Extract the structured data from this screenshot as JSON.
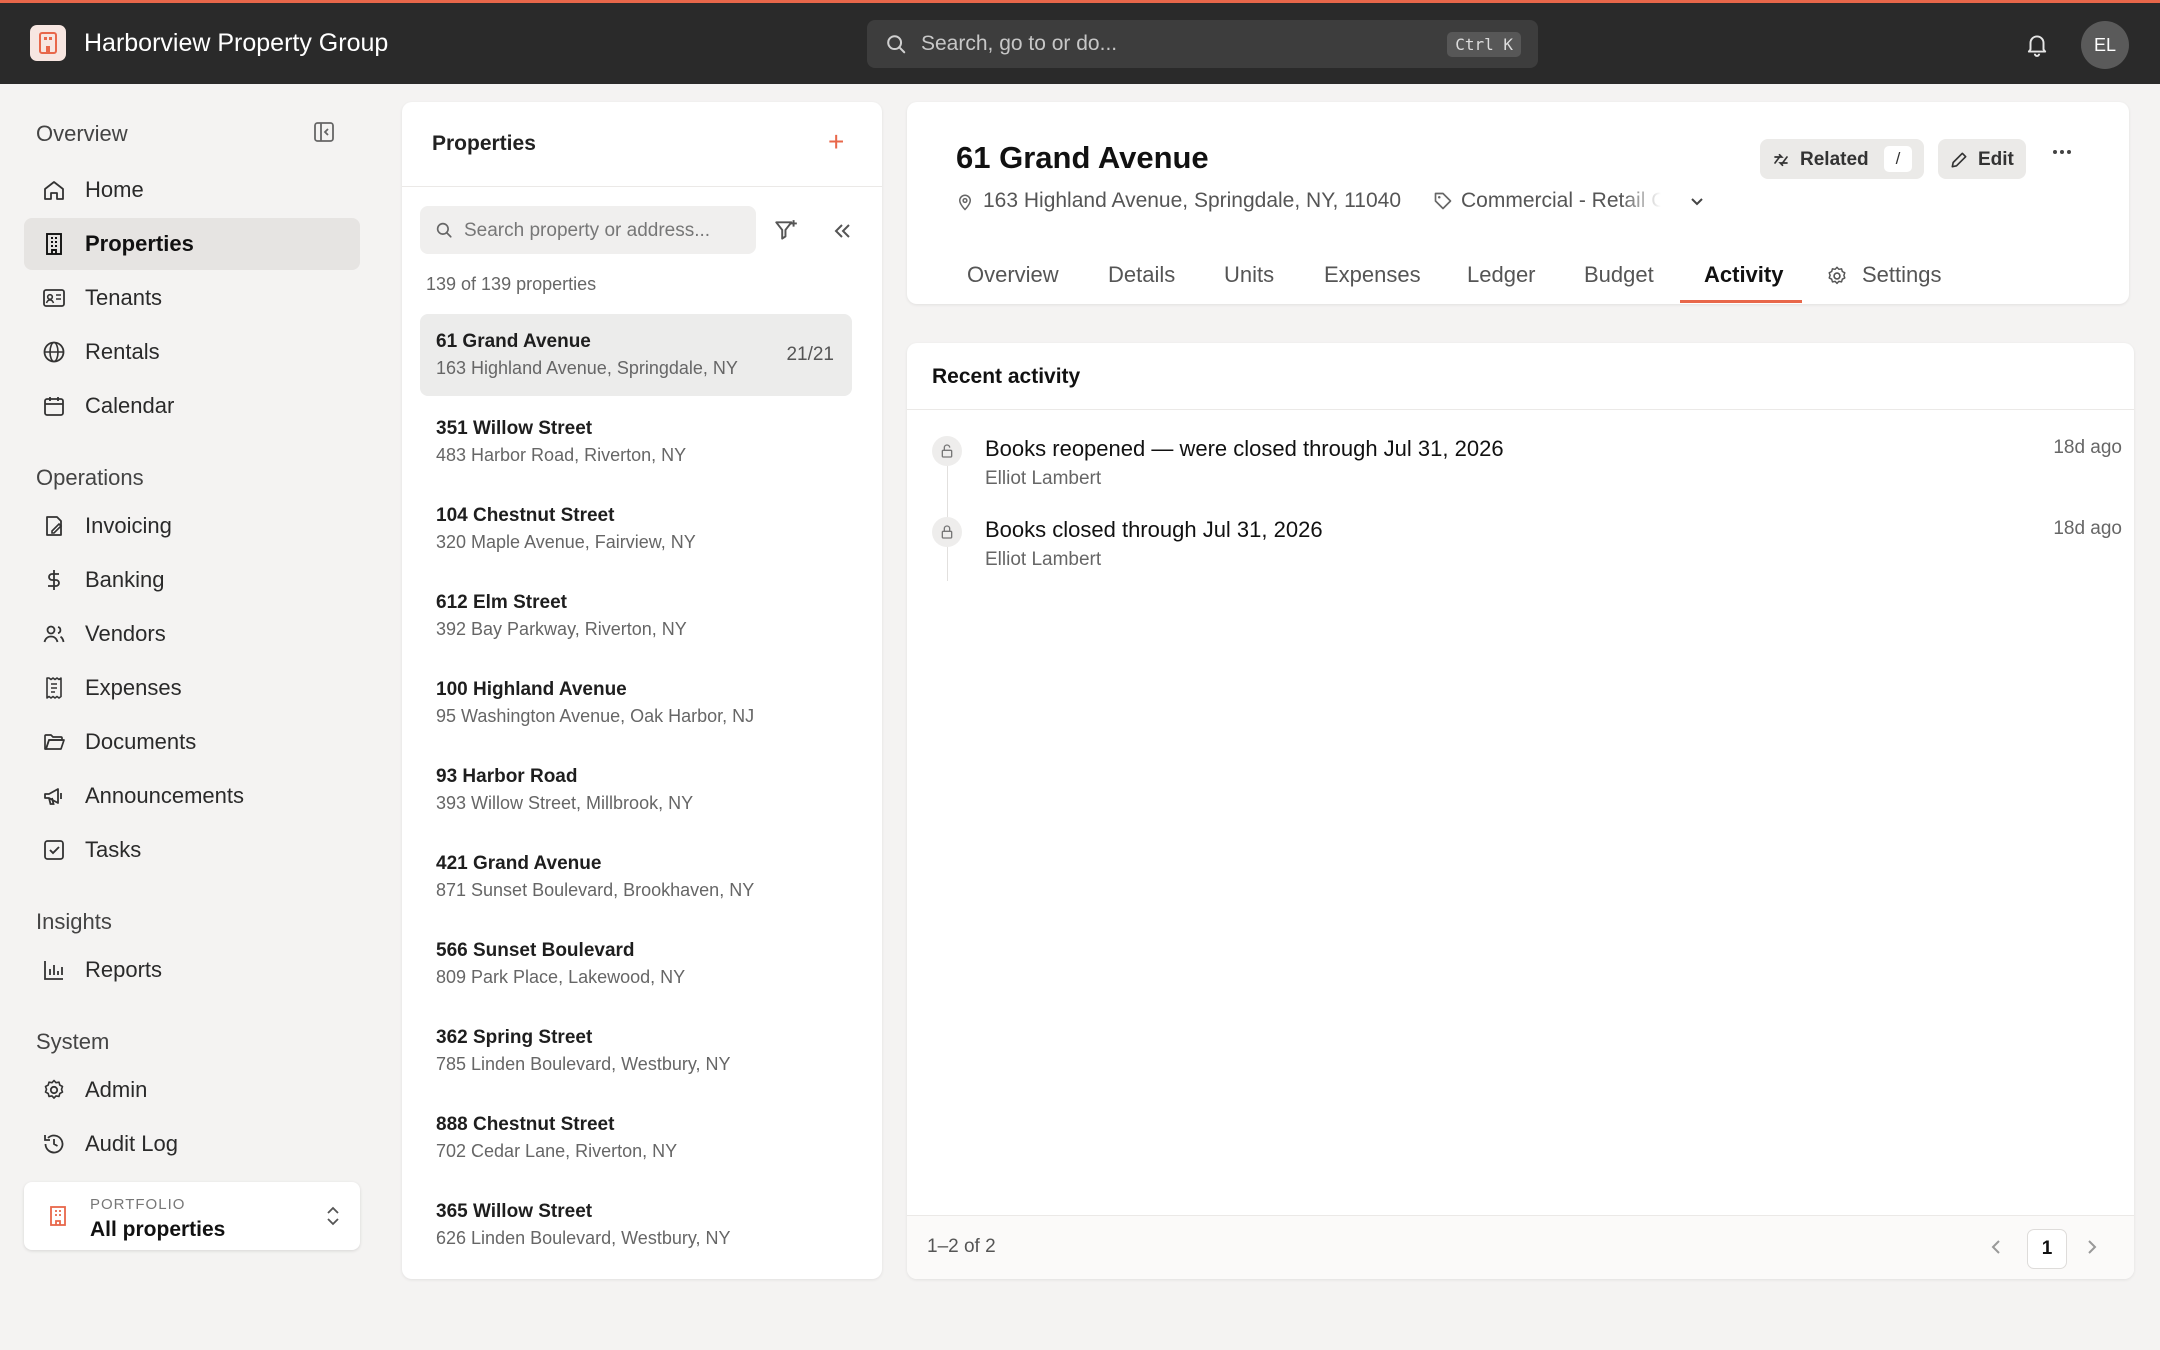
{
  "app": {
    "name": "Harborview Property Group",
    "user_initials": "EL"
  },
  "search": {
    "placeholder": "Search, go to or do...",
    "shortcut": "Ctrl K"
  },
  "sidebar": {
    "sections": [
      {
        "title": "Overview"
      },
      {
        "title": "Operations"
      },
      {
        "title": "Insights"
      },
      {
        "title": "System"
      }
    ],
    "items": [
      {
        "label": "Home",
        "icon": "home-icon"
      },
      {
        "label": "Properties",
        "icon": "building-icon",
        "active": true
      },
      {
        "label": "Tenants",
        "icon": "id-card-icon"
      },
      {
        "label": "Rentals",
        "icon": "globe-icon"
      },
      {
        "label": "Calendar",
        "icon": "calendar-icon"
      },
      {
        "label": "Invoicing",
        "icon": "invoice-icon"
      },
      {
        "label": "Banking",
        "icon": "dollar-icon"
      },
      {
        "label": "Vendors",
        "icon": "users-icon"
      },
      {
        "label": "Expenses",
        "icon": "receipt-icon"
      },
      {
        "label": "Documents",
        "icon": "folder-icon"
      },
      {
        "label": "Announcements",
        "icon": "megaphone-icon"
      },
      {
        "label": "Tasks",
        "icon": "checkbox-icon"
      },
      {
        "label": "Reports",
        "icon": "bar-chart-icon"
      },
      {
        "label": "Admin",
        "icon": "gear-icon"
      },
      {
        "label": "Audit Log",
        "icon": "history-icon"
      }
    ],
    "portfolio": {
      "caption": "PORTFOLIO",
      "value": "All properties"
    }
  },
  "properties_panel": {
    "title": "Properties",
    "search_placeholder": "Search property or address...",
    "count": "139 of 139 properties",
    "items": [
      {
        "name": "61 Grand Avenue",
        "address": "163 Highland Avenue, Springdale, NY",
        "units": "21/21",
        "selected": true
      },
      {
        "name": "351 Willow Street",
        "address": "483 Harbor Road, Riverton, NY"
      },
      {
        "name": "104 Chestnut Street",
        "address": "320 Maple Avenue, Fairview, NY"
      },
      {
        "name": "612 Elm Street",
        "address": "392 Bay Parkway, Riverton, NY"
      },
      {
        "name": "100 Highland Avenue",
        "address": "95 Washington Avenue, Oak Harbor, NJ"
      },
      {
        "name": "93 Harbor Road",
        "address": "393 Willow Street, Millbrook, NY"
      },
      {
        "name": "421 Grand Avenue",
        "address": "871 Sunset Boulevard, Brookhaven, NY"
      },
      {
        "name": "566 Sunset Boulevard",
        "address": "809 Park Place, Lakewood, NY"
      },
      {
        "name": "362 Spring Street",
        "address": "785 Linden Boulevard, Westbury, NY"
      },
      {
        "name": "888 Chestnut Street",
        "address": "702 Cedar Lane, Riverton, NY"
      },
      {
        "name": "365 Willow Street",
        "address": "626 Linden Boulevard, Westbury, NY"
      }
    ]
  },
  "property": {
    "title": "61 Grand Avenue",
    "address": "163 Highland Avenue, Springdale, NY, 11040",
    "type": "Commercial - Retail Center",
    "related_label": "Related",
    "related_shortcut": "/",
    "edit_label": "Edit",
    "tabs": [
      "Overview",
      "Details",
      "Units",
      "Expenses",
      "Ledger",
      "Budget",
      "Activity",
      "Settings"
    ],
    "active_tab": "Activity"
  },
  "activity": {
    "title": "Recent activity",
    "entries": [
      {
        "text": "Books reopened — were closed through Jul 31, 2026",
        "by": "Elliot Lambert",
        "ago": "18d ago"
      },
      {
        "text": "Books closed through Jul 31, 2026",
        "by": "Elliot Lambert",
        "ago": "18d ago"
      }
    ],
    "range": "1–2 of 2",
    "page": "1"
  },
  "colors": {
    "accent": "#e8674a",
    "topbar": "#2a2a2a"
  }
}
